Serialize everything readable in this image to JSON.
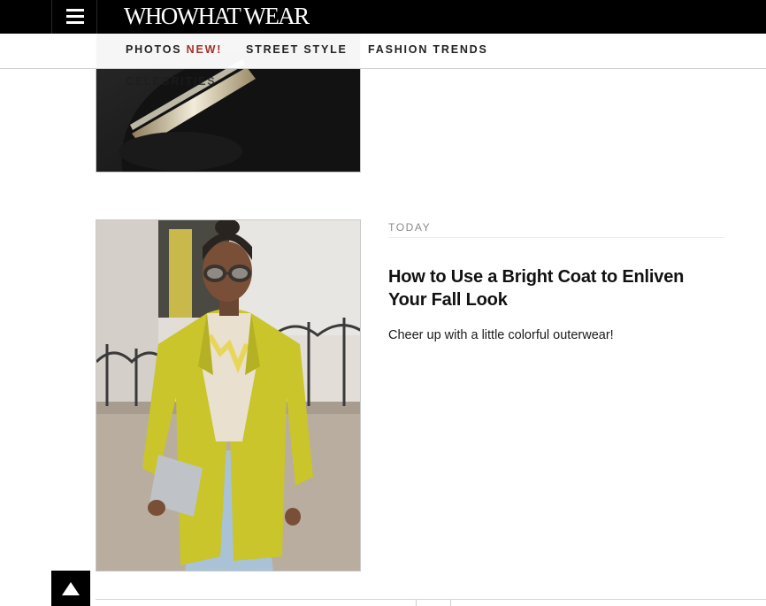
{
  "header": {
    "logo": "WHOWHAT WEAR",
    "menu_icon": "hamburger-menu-icon"
  },
  "nav": {
    "items": [
      {
        "label": "PHOTOS",
        "badge": "NEW!"
      },
      {
        "label": "STREET STYLE"
      },
      {
        "label": "FASHION TRENDS"
      }
    ],
    "overflow_label": "CELEBRITIES"
  },
  "article": {
    "date": "TODAY",
    "title": "How to Use a Bright Coat to Enliven Your Fall Look",
    "dek": "Cheer up with a little colorful outerwear!"
  },
  "back_to_top_icon": "arrow-up-icon",
  "colors": {
    "topbar_bg": "#000000",
    "new_badge": "#a3312b",
    "coat": "#c9c52a"
  }
}
